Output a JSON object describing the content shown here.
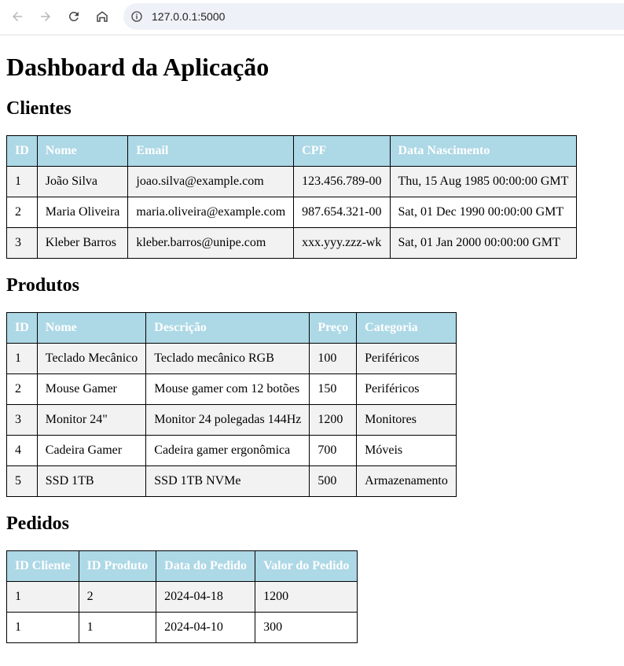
{
  "browser": {
    "url": "127.0.0.1:5000",
    "icons": [
      "back-arrow-icon",
      "forward-arrow-icon",
      "reload-icon",
      "home-icon",
      "info-icon"
    ]
  },
  "page": {
    "title": "Dashboard da Aplicação"
  },
  "clientes": {
    "heading": "Clientes",
    "headers": [
      "ID",
      "Nome",
      "Email",
      "CPF",
      "Data Nascimento"
    ],
    "rows": [
      [
        "1",
        "João Silva",
        "joao.silva@example.com",
        "123.456.789-00",
        "Thu, 15 Aug 1985 00:00:00 GMT"
      ],
      [
        "2",
        "Maria Oliveira",
        "maria.oliveira@example.com",
        "987.654.321-00",
        "Sat, 01 Dec 1990 00:00:00 GMT"
      ],
      [
        "3",
        "Kleber Barros",
        "kleber.barros@unipe.com",
        "xxx.yyy.zzz-wk",
        "Sat, 01 Jan 2000 00:00:00 GMT"
      ]
    ]
  },
  "produtos": {
    "heading": "Produtos",
    "headers": [
      "ID",
      "Nome",
      "Descrição",
      "Preço",
      "Categoria"
    ],
    "rows": [
      [
        "1",
        "Teclado Mecânico",
        "Teclado mecânico RGB",
        "100",
        "Periféricos"
      ],
      [
        "2",
        "Mouse Gamer",
        "Mouse gamer com 12 botões",
        "150",
        "Periféricos"
      ],
      [
        "3",
        "Monitor 24\"",
        "Monitor 24 polegadas 144Hz",
        "1200",
        "Monitores"
      ],
      [
        "4",
        "Cadeira Gamer",
        "Cadeira gamer ergonômica",
        "700",
        "Móveis"
      ],
      [
        "5",
        "SSD 1TB",
        "SSD 1TB NVMe",
        "500",
        "Armazenamento"
      ]
    ]
  },
  "pedidos": {
    "heading": "Pedidos",
    "headers": [
      "ID Cliente",
      "ID Produto",
      "Data do Pedido",
      "Valor do Pedido"
    ],
    "rows": [
      [
        "1",
        "2",
        "2024-04-18",
        "1200"
      ],
      [
        "1",
        "1",
        "2024-04-10",
        "300"
      ]
    ]
  },
  "colors": {
    "table_header_bg": "#add8e6",
    "table_header_text": "#ffffff",
    "row_stripe": "#f2f2f2",
    "omnibox_bg": "#eef1f7"
  }
}
